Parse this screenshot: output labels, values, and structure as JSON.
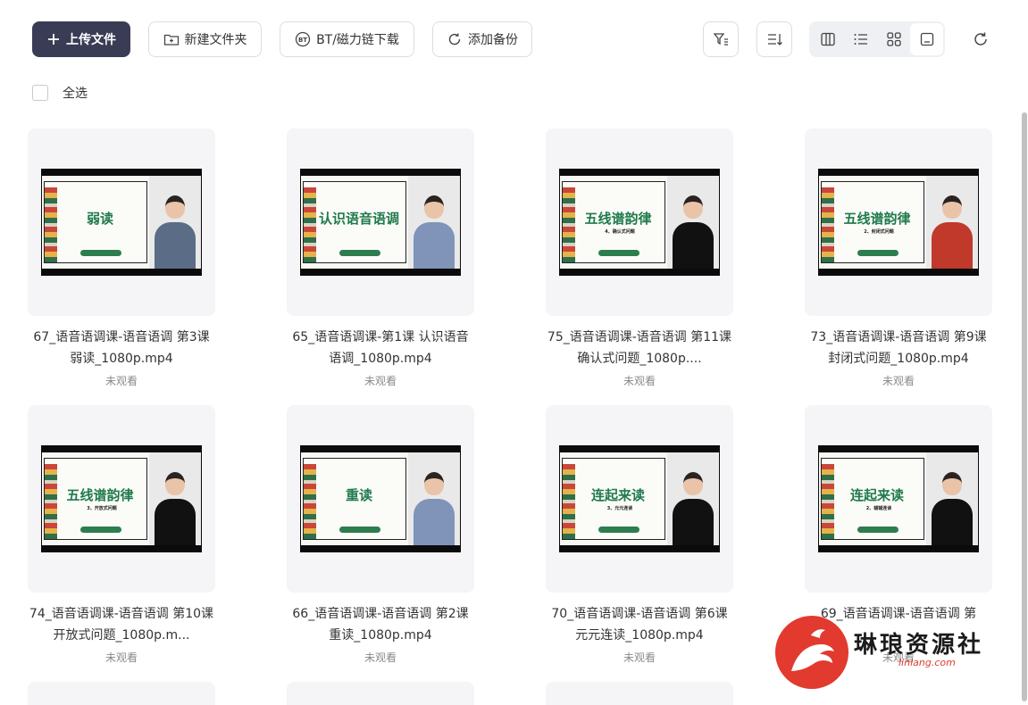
{
  "toolbar": {
    "upload_label": "上传文件",
    "new_folder_label": "新建文件夹",
    "bt_label": "BT/磁力链下载",
    "backup_label": "添加备份"
  },
  "select_all": {
    "label": "全选"
  },
  "files": [
    {
      "title": "67_语音语调课-语音语调 第3课 弱读_1080p.mp4",
      "status": "未观看",
      "slide_title": "弱读",
      "slide_sub": "",
      "shirt_color": "#5b6c86"
    },
    {
      "title": "65_语音语调课-第1课 认识语音语调_1080p.mp4",
      "status": "未观看",
      "slide_title": "认识语音语调",
      "slide_sub": "",
      "shirt_color": "#7f94b8"
    },
    {
      "title": "75_语音语调课-语音语调 第11课 确认式问题_1080p....",
      "status": "未观看",
      "slide_title": "五线谱韵律",
      "slide_sub": "4、确认式问题",
      "shirt_color": "#111111"
    },
    {
      "title": "73_语音语调课-语音语调 第9课 封闭式问题_1080p.mp4",
      "status": "未观看",
      "slide_title": "五线谱韵律",
      "slide_sub": "2、封闭式问题",
      "shirt_color": "#c0392b"
    },
    {
      "title": "74_语音语调课-语音语调 第10课开放式问题_1080p.m...",
      "status": "未观看",
      "slide_title": "五线谱韵律",
      "slide_sub": "3、开放式问题",
      "shirt_color": "#111111"
    },
    {
      "title": "66_语音语调课-语音语调 第2课 重读_1080p.mp4",
      "status": "未观看",
      "slide_title": "重读",
      "slide_sub": "",
      "shirt_color": "#7f94b8"
    },
    {
      "title": "70_语音语调课-语音语调 第6课 元元连读_1080p.mp4",
      "status": "未观看",
      "slide_title": "连起来读",
      "slide_sub": "3、元元连读",
      "shirt_color": "#111111"
    },
    {
      "title": "69_语音语调课-语音语调 第",
      "status": "未观看",
      "slide_title": "连起来读",
      "slide_sub": "2、辅辅连读",
      "shirt_color": "#111111"
    }
  ],
  "watermark": {
    "text": "琳琅资源社",
    "url": "linlang.com"
  },
  "colors": {
    "primary_button": "#3a3c55",
    "slide_green": "#1f7a4b",
    "watermark_red": "#e23a2e"
  }
}
